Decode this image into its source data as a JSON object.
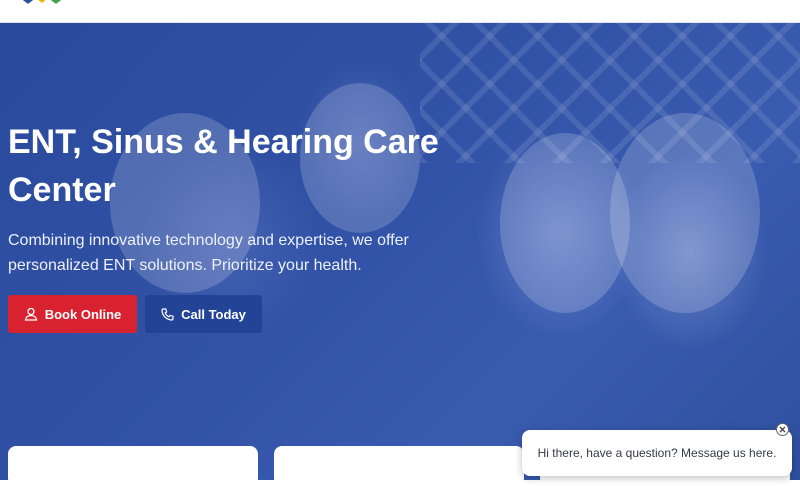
{
  "hero": {
    "title": "ENT, Sinus & Hearing Care Center",
    "subtitle": "Combining innovative technology and expertise, we offer personalized ENT solutions. Prioritize your health."
  },
  "buttons": {
    "book_label": "Book Online",
    "book_icon": "user-icon",
    "call_label": "Call Today",
    "call_icon": "phone-icon"
  },
  "chat": {
    "message": "Hi there, have a question? Message us here.",
    "close_icon": "close-icon"
  },
  "colors": {
    "hero_overlay": "#3152a6",
    "book_button": "#d8222f",
    "call_button": "#234496"
  }
}
